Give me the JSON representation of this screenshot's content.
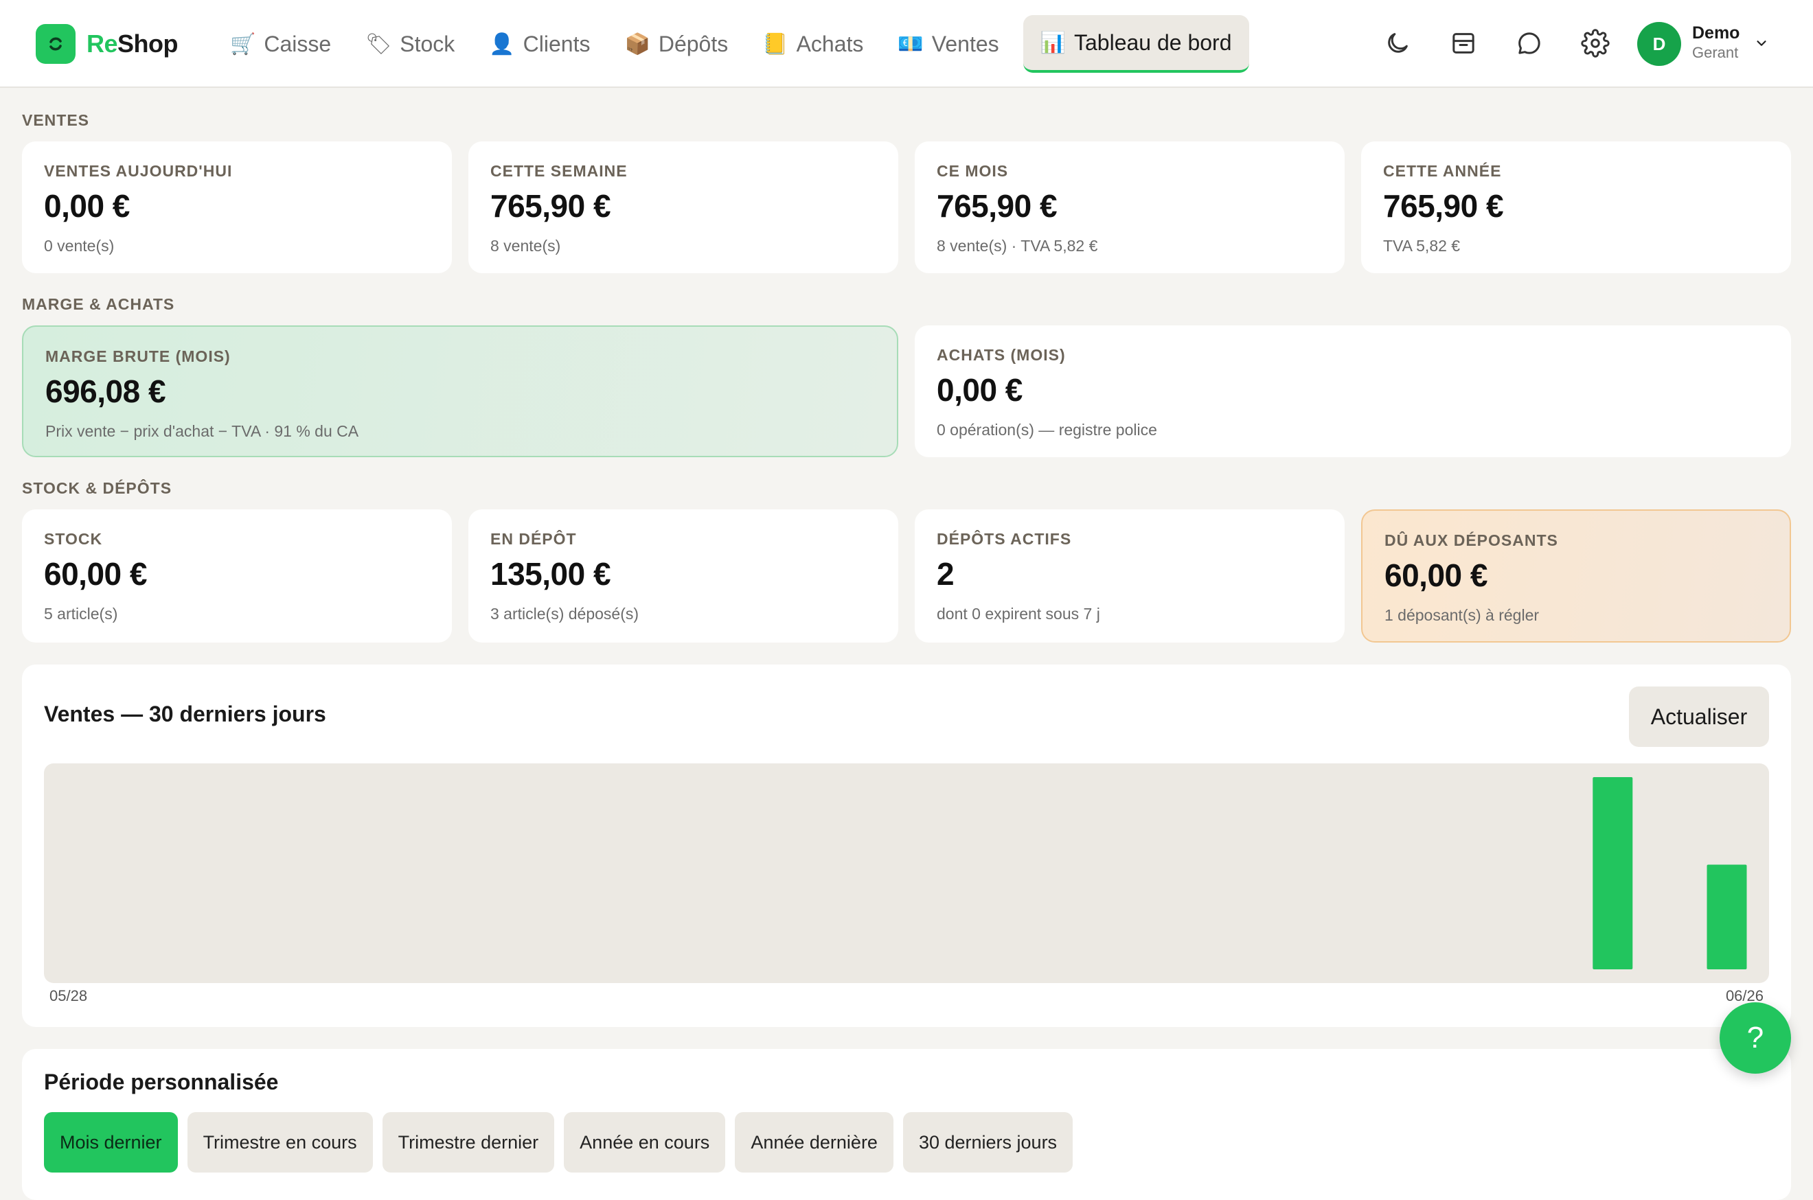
{
  "brand": {
    "name_part1": "Re",
    "name_part2": "Shop"
  },
  "nav": [
    {
      "icon": "🛒",
      "label": "Caisse"
    },
    {
      "icon": "🏷",
      "label": "Stock"
    },
    {
      "icon": "👤",
      "label": "Clients"
    },
    {
      "icon": "📦",
      "label": "Dépôts"
    },
    {
      "icon": "📒",
      "label": "Achats"
    },
    {
      "icon": "💶",
      "label": "Ventes"
    },
    {
      "icon": "📊",
      "label": "Tableau de bord",
      "active": true
    }
  ],
  "toolbar_icons": [
    "moon-icon",
    "archive-icon",
    "chat-icon",
    "gear-icon"
  ],
  "user": {
    "initial": "D",
    "name": "Demo",
    "role": "Gerant"
  },
  "sections": {
    "ventes": "VENTES",
    "marge": "MARGE & ACHATS",
    "stock": "STOCK & DÉPÔTS"
  },
  "ventes": [
    {
      "label": "VENTES AUJOURD'HUI",
      "value": "0,00 €",
      "sub": "0 vente(s)"
    },
    {
      "label": "CETTE SEMAINE",
      "value": "765,90 €",
      "sub": "8 vente(s)"
    },
    {
      "label": "CE MOIS",
      "value": "765,90 €",
      "sub": "8 vente(s) · TVA 5,82 €"
    },
    {
      "label": "CETTE ANNÉE",
      "value": "765,90 €",
      "sub": "TVA 5,82 €"
    }
  ],
  "marge": [
    {
      "label": "MARGE BRUTE (MOIS)",
      "value": "696,08 €",
      "sub": "Prix vente − prix d'achat − TVA · 91 % du CA"
    },
    {
      "label": "ACHATS (MOIS)",
      "value": "0,00 €",
      "sub": "0 opération(s) — registre police"
    }
  ],
  "stock": [
    {
      "label": "STOCK",
      "value": "60,00 €",
      "sub": "5 article(s)"
    },
    {
      "label": "EN DÉPÔT",
      "value": "135,00 €",
      "sub": "3 article(s) déposé(s)"
    },
    {
      "label": "DÉPÔTS ACTIFS",
      "value": "2",
      "sub": "dont 0 expirent sous 7 j"
    },
    {
      "label": "DÛ AUX DÉPOSANTS",
      "value": "60,00 €",
      "sub": "1 déposant(s) à régler"
    }
  ],
  "chart": {
    "title": "Ventes — 30 derniers jours",
    "refresh_label": "Actualiser",
    "x_start_label": "05/28",
    "x_end_label": "06/26"
  },
  "chart_data": {
    "type": "bar",
    "title": "Ventes — 30 derniers jours",
    "x": [
      "05/28",
      "05/29",
      "05/30",
      "05/31",
      "06/01",
      "06/02",
      "06/03",
      "06/04",
      "06/05",
      "06/06",
      "06/07",
      "06/08",
      "06/09",
      "06/10",
      "06/11",
      "06/12",
      "06/13",
      "06/14",
      "06/15",
      "06/16",
      "06/17",
      "06/18",
      "06/19",
      "06/20",
      "06/21",
      "06/22",
      "06/23",
      "06/24",
      "06/25",
      "06/26"
    ],
    "values": [
      0,
      0,
      0,
      0,
      0,
      0,
      0,
      0,
      0,
      0,
      0,
      0,
      0,
      0,
      0,
      0,
      0,
      0,
      0,
      0,
      0,
      0,
      0,
      0,
      0,
      0,
      0,
      495.9,
      0,
      270
    ],
    "xlabel": "",
    "ylabel": "",
    "bar_color": "#22c55e",
    "plot_bg": "#ece9e3"
  },
  "period": {
    "title": "Période personnalisée",
    "buttons": [
      {
        "label": "Mois dernier",
        "active": true
      },
      {
        "label": "Trimestre en cours"
      },
      {
        "label": "Trimestre dernier"
      },
      {
        "label": "Année en cours"
      },
      {
        "label": "Année dernière"
      },
      {
        "label": "30 derniers jours"
      }
    ]
  },
  "help": {
    "label": "?"
  },
  "colors": {
    "accent": "#22c55e",
    "background": "#f5f4f1"
  }
}
